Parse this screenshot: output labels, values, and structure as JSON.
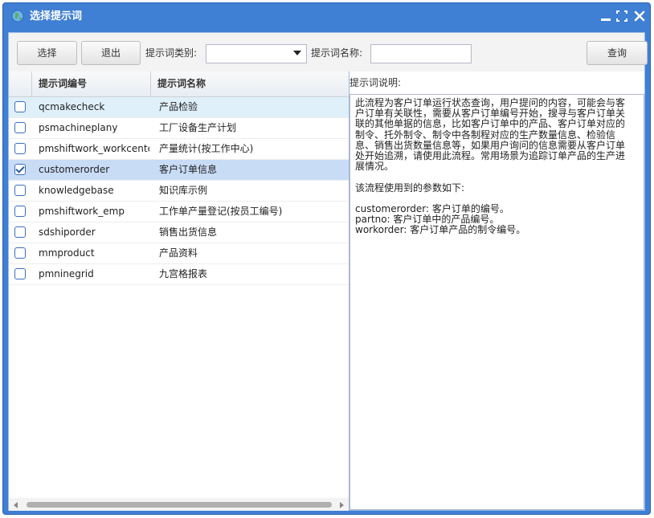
{
  "window": {
    "title": "选择提示词",
    "icon": "globe-icon",
    "controls": [
      "minimize-icon",
      "maximize-icon",
      "close-icon"
    ]
  },
  "toolbar": {
    "select_label": "选择",
    "exit_label": "退出",
    "category_label": "提示词类别:",
    "category_value": "",
    "name_label": "提示词名称:",
    "name_value": "",
    "query_label": "查询"
  },
  "grid": {
    "columns": [
      "提示词编号",
      "提示词名称"
    ],
    "rows": [
      {
        "code": "qcmakecheck",
        "name": "产品检验",
        "checked": false,
        "hover": true
      },
      {
        "code": "psmachineplany",
        "name": "工厂设备生产计划",
        "checked": false
      },
      {
        "code": "pmshiftwork_workcenter",
        "name": "产量统计(按工作中心)",
        "checked": false
      },
      {
        "code": "customerorder",
        "name": "客户订单信息",
        "checked": true,
        "selected": true
      },
      {
        "code": "knowledgebase",
        "name": "知识库示例",
        "checked": false
      },
      {
        "code": "pmshiftwork_emp",
        "name": "工作单产量登记(按员工编号)",
        "checked": false
      },
      {
        "code": "sdshiporder",
        "name": "销售出货信息",
        "checked": false
      },
      {
        "code": "mmproduct",
        "name": "产品资料",
        "checked": false
      },
      {
        "code": "pmninegrid",
        "name": "九宫格报表",
        "checked": false
      }
    ]
  },
  "description": {
    "label": "提示词说明:",
    "lines": [
      "此流程为客户订单运行状态查询，用户提问的内容，可能会与客",
      "户订单有关联性，需要从客户订单编号开始，搜寻与客户订单关",
      "联的其他单据的信息，比如客户订单中的产品、客户订单对应的",
      "制令、托外制令、制令中各制程对应的生产数量信息、检验信",
      "息、销售出货数量信息等，如果用户询问的信息需要从客户订单",
      "处开始追溯，请使用此流程。常用场景为追踪订单产品的生产进",
      "展情况。",
      "",
      "该流程使用到的参数如下:",
      "",
      "customerorder: 客户订单的编号。",
      "partno: 客户订单中的产品编号。",
      "workorder: 客户订单产品的制令编号。"
    ]
  },
  "colors": {
    "titlebar": "#3f7fd4",
    "selected_row": "#c9dcf6",
    "hover_row": "#dff0fb",
    "border": "#99bbe8"
  }
}
